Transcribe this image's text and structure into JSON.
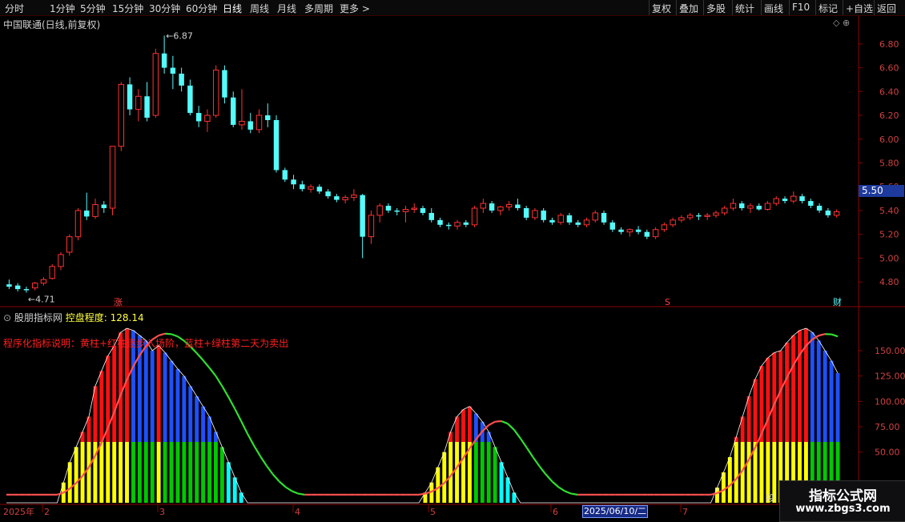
{
  "toolbar": {
    "left": [
      "分时",
      "1分钟",
      "5分钟",
      "15分钟",
      "30分钟",
      "60分钟",
      "日线",
      "周线",
      "月线",
      "多周期",
      "更多 >"
    ],
    "right": [
      "复权",
      "叠加",
      "多股",
      "统计",
      "画线",
      "F10",
      "标记",
      "+自选",
      "返回"
    ],
    "active": "日线"
  },
  "main_chart": {
    "title": "中国联通(日线,前复权)",
    "icons": "◇ ⊕",
    "high_label": "6.87",
    "low_label": "4.71",
    "current_price": "5.50",
    "markers": {
      "zhang": "涨",
      "s": "S",
      "cai": "财"
    }
  },
  "indicator": {
    "name": "股朋指标网",
    "param_label": "控盘程度:",
    "param_value": "128.14",
    "description": "程序化指标说明：黄柱+红柱逐步入场阶，蓝柱+绿柱第二天为卖出"
  },
  "date_axis": {
    "year_label": "2025年",
    "month_labels": [
      "2",
      "3",
      "4",
      "5",
      "6",
      "7"
    ],
    "cursor_date": "2025/06/10/二",
    "end_label": "段"
  },
  "watermark": {
    "title": "指标公式网",
    "url": "www.zbgs3.com"
  },
  "colors": {
    "up": "#ff3232",
    "down": "#54fcfc",
    "axis": "#8b0000",
    "yellow": "#ffff00",
    "red": "#ff1010",
    "blue": "#1e50ff",
    "green": "#00c800",
    "cyan": "#00ffff"
  },
  "chart_data": [
    {
      "type": "candlestick",
      "title": "中国联通(日线,前复权)",
      "ylim": [
        4.68,
        6.9
      ],
      "yticks": [
        4.8,
        5.0,
        5.2,
        5.4,
        5.6,
        5.8,
        6.0,
        6.2,
        6.4,
        6.6,
        6.8
      ],
      "ohlc": [
        [
          4.78,
          4.82,
          4.74,
          4.76
        ],
        [
          4.77,
          4.79,
          4.72,
          4.74
        ],
        [
          4.74,
          4.76,
          4.71,
          4.73
        ],
        [
          4.75,
          4.8,
          4.73,
          4.79
        ],
        [
          4.79,
          4.84,
          4.77,
          4.82
        ],
        [
          4.83,
          4.95,
          4.82,
          4.93
        ],
        [
          4.93,
          5.05,
          4.9,
          5.03
        ],
        [
          5.05,
          5.2,
          5.02,
          5.18
        ],
        [
          5.18,
          5.42,
          5.15,
          5.4
        ],
        [
          5.4,
          5.55,
          5.32,
          5.35
        ],
        [
          5.35,
          5.5,
          5.33,
          5.45
        ],
        [
          5.45,
          5.48,
          5.38,
          5.42
        ],
        [
          5.42,
          5.8,
          5.36,
          5.94
        ],
        [
          5.94,
          6.48,
          5.9,
          6.46
        ],
        [
          6.46,
          6.52,
          6.2,
          6.25
        ],
        [
          6.25,
          6.42,
          6.15,
          6.36
        ],
        [
          6.36,
          6.48,
          6.15,
          6.18
        ],
        [
          6.2,
          6.76,
          6.18,
          6.72
        ],
        [
          6.72,
          6.87,
          6.55,
          6.6
        ],
        [
          6.6,
          6.7,
          6.42,
          6.55
        ],
        [
          6.55,
          6.6,
          6.4,
          6.45
        ],
        [
          6.45,
          6.5,
          6.2,
          6.22
        ],
        [
          6.22,
          6.28,
          6.1,
          6.15
        ],
        [
          6.15,
          6.25,
          6.06,
          6.2
        ],
        [
          6.2,
          6.62,
          6.18,
          6.58
        ],
        [
          6.58,
          6.62,
          6.3,
          6.35
        ],
        [
          6.35,
          6.4,
          6.1,
          6.12
        ],
        [
          6.12,
          6.42,
          6.08,
          6.15
        ],
        [
          6.15,
          6.22,
          6.05,
          6.08
        ],
        [
          6.08,
          6.25,
          6.05,
          6.2
        ],
        [
          6.2,
          6.3,
          6.1,
          6.16
        ],
        [
          6.16,
          6.2,
          5.72,
          5.74
        ],
        [
          5.74,
          5.76,
          5.64,
          5.66
        ],
        [
          5.66,
          5.7,
          5.58,
          5.62
        ],
        [
          5.62,
          5.65,
          5.56,
          5.58
        ],
        [
          5.58,
          5.62,
          5.55,
          5.6
        ],
        [
          5.6,
          5.62,
          5.54,
          5.56
        ],
        [
          5.56,
          5.58,
          5.5,
          5.52
        ],
        [
          5.52,
          5.54,
          5.47,
          5.49
        ],
        [
          5.49,
          5.53,
          5.46,
          5.51
        ],
        [
          5.51,
          5.58,
          5.48,
          5.53
        ],
        [
          5.53,
          5.54,
          5.0,
          5.18
        ],
        [
          5.18,
          5.4,
          5.12,
          5.36
        ],
        [
          5.36,
          5.46,
          5.3,
          5.44
        ],
        [
          5.44,
          5.46,
          5.38,
          5.4
        ],
        [
          5.4,
          5.42,
          5.36,
          5.39
        ],
        [
          5.39,
          5.44,
          5.3,
          5.41
        ],
        [
          5.41,
          5.46,
          5.38,
          5.42
        ],
        [
          5.42,
          5.44,
          5.36,
          5.38
        ],
        [
          5.38,
          5.42,
          5.3,
          5.32
        ],
        [
          5.32,
          5.34,
          5.26,
          5.28
        ],
        [
          5.28,
          5.3,
          5.24,
          5.27
        ],
        [
          5.27,
          5.32,
          5.24,
          5.3
        ],
        [
          5.3,
          5.32,
          5.26,
          5.28
        ],
        [
          5.28,
          5.44,
          5.26,
          5.42
        ],
        [
          5.42,
          5.5,
          5.38,
          5.46
        ],
        [
          5.46,
          5.48,
          5.38,
          5.4
        ],
        [
          5.4,
          5.44,
          5.36,
          5.43
        ],
        [
          5.43,
          5.48,
          5.4,
          5.45
        ],
        [
          5.45,
          5.5,
          5.4,
          5.42
        ],
        [
          5.42,
          5.44,
          5.32,
          5.34
        ],
        [
          5.34,
          5.42,
          5.32,
          5.4
        ],
        [
          5.4,
          5.42,
          5.3,
          5.32
        ],
        [
          5.32,
          5.34,
          5.28,
          5.3
        ],
        [
          5.3,
          5.38,
          5.28,
          5.36
        ],
        [
          5.36,
          5.38,
          5.28,
          5.3
        ],
        [
          5.3,
          5.32,
          5.26,
          5.28
        ],
        [
          5.28,
          5.34,
          5.26,
          5.32
        ],
        [
          5.32,
          5.4,
          5.3,
          5.38
        ],
        [
          5.38,
          5.4,
          5.28,
          5.3
        ],
        [
          5.3,
          5.32,
          5.22,
          5.24
        ],
        [
          5.24,
          5.26,
          5.2,
          5.22
        ],
        [
          5.22,
          5.25,
          5.18,
          5.24
        ],
        [
          5.24,
          5.27,
          5.2,
          5.22
        ],
        [
          5.22,
          5.24,
          5.16,
          5.18
        ],
        [
          5.18,
          5.26,
          5.16,
          5.24
        ],
        [
          5.24,
          5.3,
          5.22,
          5.28
        ],
        [
          5.28,
          5.34,
          5.26,
          5.32
        ],
        [
          5.32,
          5.36,
          5.3,
          5.34
        ],
        [
          5.34,
          5.38,
          5.32,
          5.36
        ],
        [
          5.36,
          5.38,
          5.32,
          5.35
        ],
        [
          5.35,
          5.38,
          5.32,
          5.36
        ],
        [
          5.36,
          5.4,
          5.34,
          5.38
        ],
        [
          5.38,
          5.44,
          5.36,
          5.42
        ],
        [
          5.42,
          5.5,
          5.4,
          5.46
        ],
        [
          5.46,
          5.48,
          5.4,
          5.42
        ],
        [
          5.42,
          5.46,
          5.38,
          5.44
        ],
        [
          5.44,
          5.46,
          5.4,
          5.41
        ],
        [
          5.41,
          5.48,
          5.4,
          5.46
        ],
        [
          5.46,
          5.52,
          5.44,
          5.5
        ],
        [
          5.5,
          5.52,
          5.46,
          5.48
        ],
        [
          5.48,
          5.56,
          5.46,
          5.52
        ],
        [
          5.52,
          5.54,
          5.46,
          5.48
        ],
        [
          5.48,
          5.5,
          5.42,
          5.44
        ],
        [
          5.44,
          5.46,
          5.38,
          5.4
        ],
        [
          5.4,
          5.42,
          5.34,
          5.36
        ],
        [
          5.36,
          5.41,
          5.34,
          5.39
        ]
      ]
    },
    {
      "type": "bar",
      "title": "控盘程度",
      "ylim": [
        0,
        180
      ],
      "yticks": [
        50,
        75,
        100,
        125,
        150
      ],
      "series": [
        {
          "name": "控盘程度",
          "values": [
            0,
            0,
            0,
            0,
            0,
            0,
            0,
            0,
            0,
            20,
            40,
            55,
            70,
            85,
            115,
            130,
            145,
            155,
            168,
            172,
            170,
            165,
            160,
            150,
            155,
            148,
            140,
            132,
            125,
            115,
            105,
            95,
            85,
            70,
            55,
            40,
            25,
            10,
            0,
            0,
            0,
            0,
            0,
            0,
            0,
            0,
            0,
            0,
            0,
            0,
            0,
            0,
            0,
            0,
            0,
            0,
            0,
            0,
            0,
            0,
            0,
            0,
            0,
            0,
            0,
            0,
            10,
            20,
            35,
            50,
            70,
            85,
            92,
            95,
            88,
            80,
            70,
            55,
            40,
            25,
            10,
            0,
            0,
            0,
            0,
            0,
            0,
            0,
            0,
            0,
            0,
            0,
            0,
            0,
            0,
            0,
            0,
            0,
            0,
            0,
            0,
            0,
            0,
            0,
            0,
            0,
            0,
            0,
            0,
            0,
            0,
            0,
            15,
            30,
            45,
            65,
            85,
            105,
            122,
            135,
            143,
            148,
            150,
            158,
            165,
            170,
            172,
            168,
            160,
            150,
            140,
            128
          ]
        }
      ]
    }
  ]
}
